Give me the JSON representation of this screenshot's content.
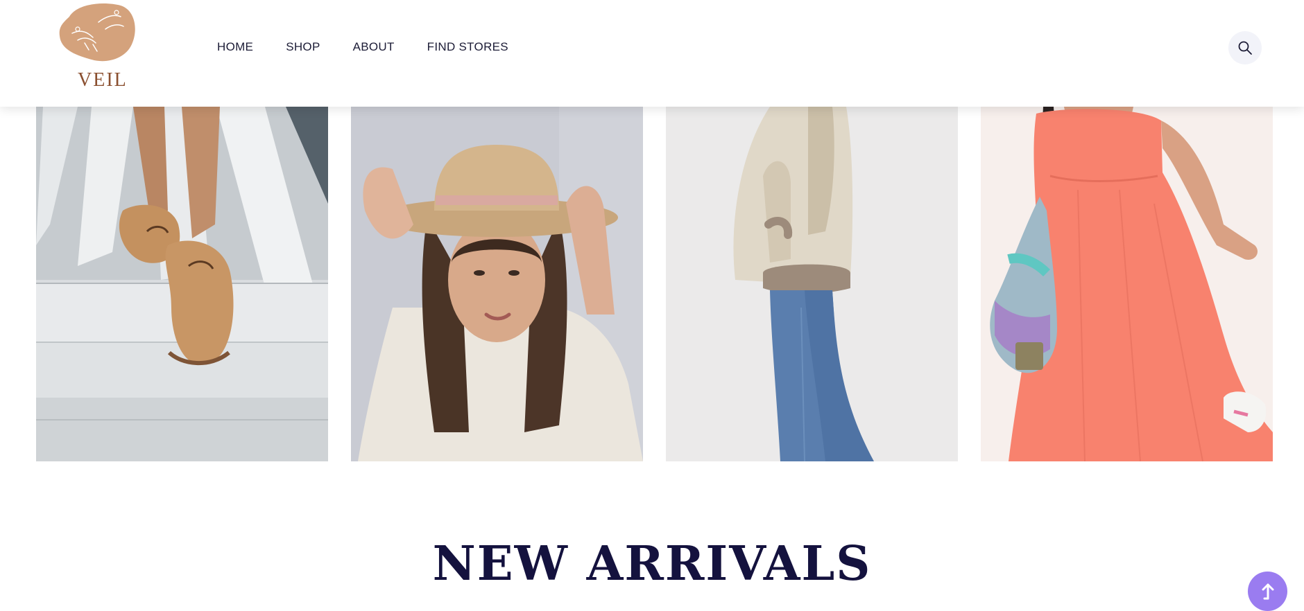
{
  "brand": {
    "name": "VEIL"
  },
  "nav": {
    "items": [
      {
        "label": "HOME"
      },
      {
        "label": "SHOP"
      },
      {
        "label": "ABOUT"
      },
      {
        "label": "FIND STORES"
      }
    ]
  },
  "header": {
    "search_icon": "search-icon"
  },
  "gallery": {
    "images": [
      {
        "name": "boat-shoes-photo"
      },
      {
        "name": "straw-hat-woman-photo"
      },
      {
        "name": "shearling-jacket-photo"
      },
      {
        "name": "coral-maxi-dress-photo"
      }
    ]
  },
  "section": {
    "title": "NEW ARRIVALS"
  },
  "colors": {
    "logo_accent": "#d4a27c",
    "heading": "#14123e",
    "scroll_button": "#9a7cf0"
  },
  "scroll_top": {
    "icon": "arrow-up-icon"
  }
}
